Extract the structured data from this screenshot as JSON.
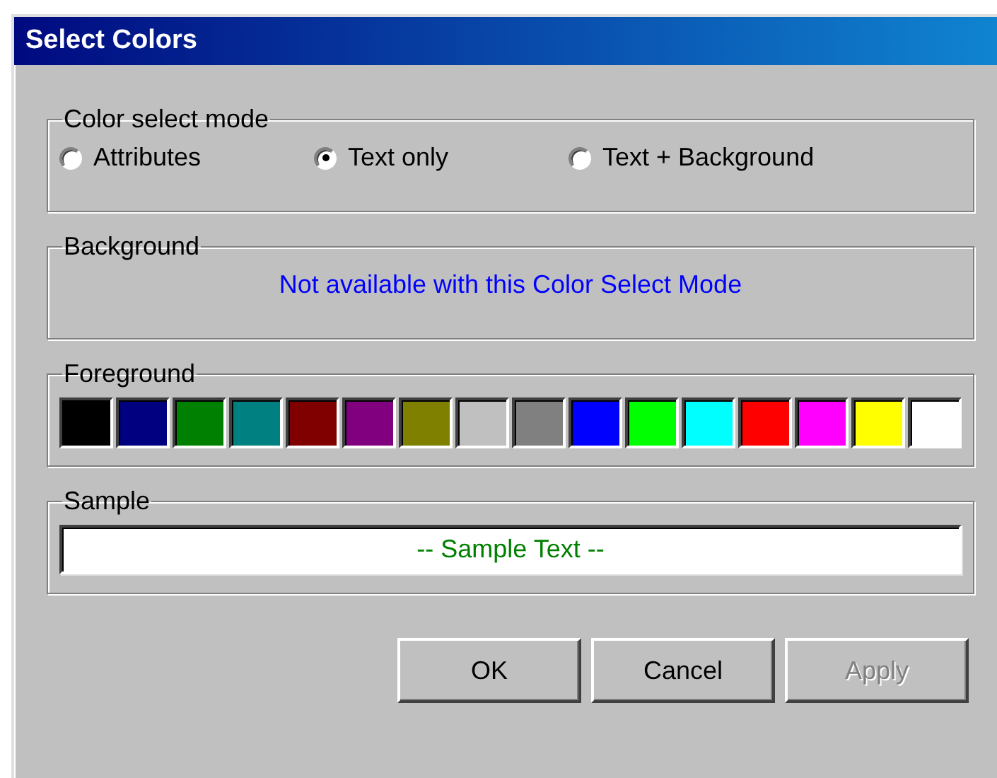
{
  "window": {
    "title": "Select Colors"
  },
  "color_select_mode": {
    "label": "Color select mode",
    "options": [
      {
        "label": "Attributes",
        "selected": false
      },
      {
        "label": "Text only",
        "selected": true
      },
      {
        "label": "Text + Background",
        "selected": false
      }
    ]
  },
  "background": {
    "label": "Background",
    "message": "Not available with this Color Select Mode"
  },
  "foreground": {
    "label": "Foreground",
    "swatches": [
      {
        "color": "#000000"
      },
      {
        "color": "#000080"
      },
      {
        "color": "#008000"
      },
      {
        "color": "#008080"
      },
      {
        "color": "#800000"
      },
      {
        "color": "#800080"
      },
      {
        "color": "#808000"
      },
      {
        "color": "#c0c0c0"
      },
      {
        "color": "#808080"
      },
      {
        "color": "#0000ff"
      },
      {
        "color": "#00ff00"
      },
      {
        "color": "#00ffff"
      },
      {
        "color": "#ff0000"
      },
      {
        "color": "#ff00ff"
      },
      {
        "color": "#ffff00"
      },
      {
        "color": "#ffffff"
      }
    ]
  },
  "sample": {
    "label": "Sample",
    "text": "-- Sample Text --"
  },
  "buttons": [
    {
      "label": "OK",
      "disabled": false
    },
    {
      "label": "Cancel",
      "disabled": false
    },
    {
      "label": "Apply",
      "disabled": true
    }
  ]
}
